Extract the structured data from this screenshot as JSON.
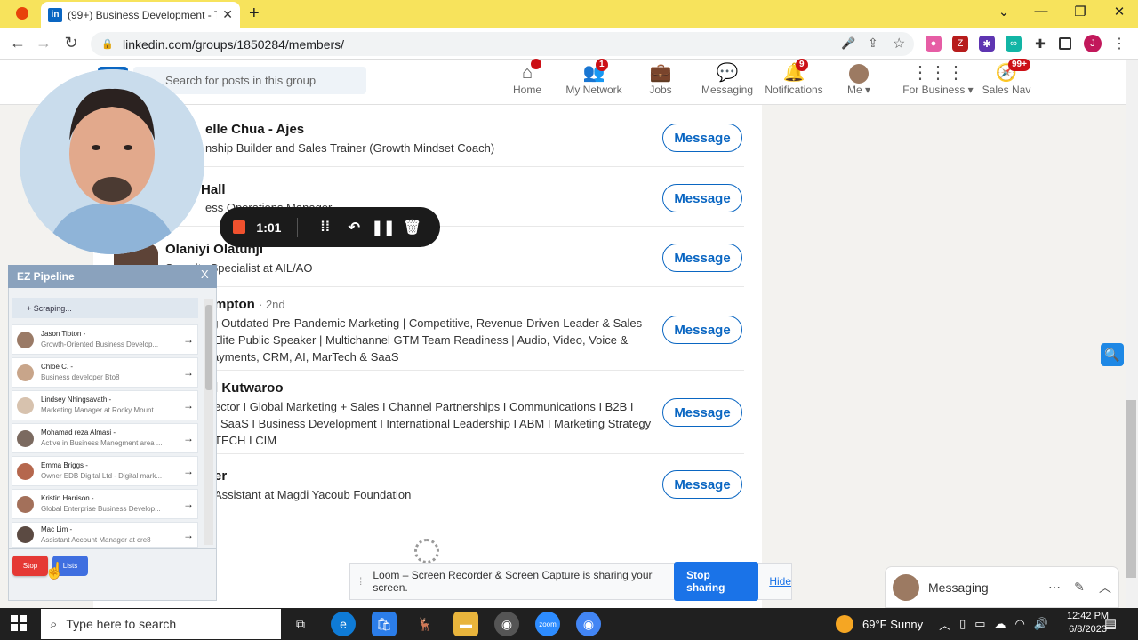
{
  "browser": {
    "tab_title": "(99+) Business Development - Th",
    "tab_favicon": "in",
    "url": "linkedin.com/groups/1850284/members/"
  },
  "linkedin": {
    "search_placeholder": "Search for posts in this group",
    "nav": [
      {
        "label": "Home",
        "icon": "home-icon",
        "badge": ""
      },
      {
        "label": "My Network",
        "icon": "network-icon",
        "badge": "1"
      },
      {
        "label": "Jobs",
        "icon": "briefcase-icon",
        "badge": ""
      },
      {
        "label": "Messaging",
        "icon": "chat-icon",
        "badge": ""
      },
      {
        "label": "Notifications",
        "icon": "bell-icon",
        "badge": "9"
      },
      {
        "label": "Me",
        "icon": "avatar",
        "badge": ""
      },
      {
        "label": "For Business",
        "icon": "grid-icon",
        "badge": ""
      },
      {
        "label": "Sales Nav",
        "icon": "compass-icon",
        "badge": "99+"
      }
    ],
    "members": [
      {
        "name": "elle Chua - Ajes",
        "degree": "",
        "headline": [
          "nship Builder and Sales Trainer (Growth Mindset Coach)"
        ]
      },
      {
        "name": "Hall",
        "degree": "",
        "headline": [
          "ess Operations Manager"
        ]
      },
      {
        "name": "Olaniyi Olatunji",
        "degree": "",
        "headline": [
          "Security Specialist at AIL/AO"
        ]
      },
      {
        "name": "mpton",
        "degree": "· 2nd",
        "headline": [
          "ng Outdated Pre-Pandemic Marketing | Competitive, Revenue-Driven Leader & Sales",
          "Elite Public Speaker | Multichannel GTM Team Readiness | Audio, Video, Voice &",
          "ayments, CRM, AI, MarTech & SaaS"
        ]
      },
      {
        "name": "l Kutwaroo",
        "degree": "",
        "headline": [
          "ector I Global Marketing + Sales I Channel Partnerships I Communications I B2B I",
          "SaaS I Business Development I International Leadership I ABM I Marketing Strategy",
          "TECH I CIM"
        ]
      },
      {
        "name": "er",
        "degree": "",
        "headline": [
          "Assistant at Magdi Yacoub Foundation"
        ]
      }
    ],
    "message_label": "Message",
    "messaging_label": "Messaging"
  },
  "loom": {
    "timer": "1:01",
    "share_text": "Loom – Screen Recorder & Screen Capture is sharing your screen.",
    "stop_sharing": "Stop sharing",
    "hide": "Hide"
  },
  "ez_pipeline": {
    "title": "EZ Pipeline",
    "close": "X",
    "status": "+ Scraping...",
    "leads": [
      {
        "name": "Jason Tipton -",
        "sub": "Growth-Oriented Business Develop..."
      },
      {
        "name": "Chloé C. -",
        "sub": "Business developer Bto8"
      },
      {
        "name": "Lindsey Nhingsavath -",
        "sub": "Marketing Manager at Rocky Mount..."
      },
      {
        "name": "Mohamad reza Almasi -",
        "sub": "Active in Business Manegment area ..."
      },
      {
        "name": "Emma Briggs -",
        "sub": "Owner EDB Digital Ltd - Digital mark..."
      },
      {
        "name": "Kristin Harrison -",
        "sub": "Global Enterprise Business Develop..."
      },
      {
        "name": "Mac Lim -",
        "sub": "Assistant Account Manager at cre8"
      }
    ],
    "stop": "Stop",
    "lists": "Lists"
  },
  "taskbar": {
    "search_placeholder": "Type here to search",
    "weather": "69°F  Sunny",
    "time": "12:42 PM",
    "date": "6/8/2023"
  },
  "colors": {
    "linkedin_blue": "#0a66c2",
    "tab_bar": "#f7e35c",
    "loom_orange": "#f0512e"
  }
}
